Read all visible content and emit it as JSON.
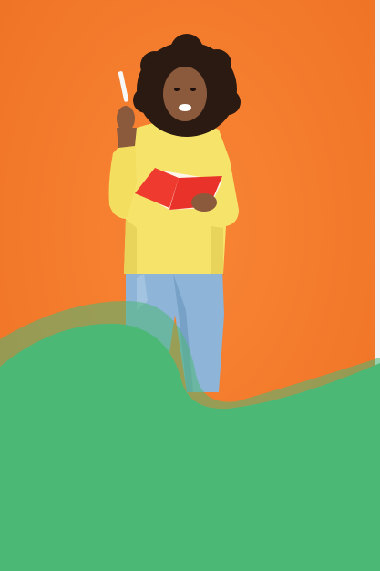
{
  "scene": {
    "subject_icon": "person-holding-notebook-and-pen",
    "colors": {
      "background_orange": "#f57a2a",
      "background_orange_dark": "#ee6b1f",
      "skin": "#8b5a3c",
      "hair": "#2b1a12",
      "sweater_yellow": "#f6e46a",
      "sweater_shadow": "#e8d45a",
      "notebook_red": "#ef3b2f",
      "notebook_pages": "#fff5e8",
      "pen_white": "#f7f7f7",
      "jeans_blue": "#8eb4d8",
      "jeans_shadow": "#6f98c0",
      "wave_green": "#4cb876",
      "wave_green_translucent": "#4cb876",
      "right_strip": "#f2f2f2"
    }
  }
}
